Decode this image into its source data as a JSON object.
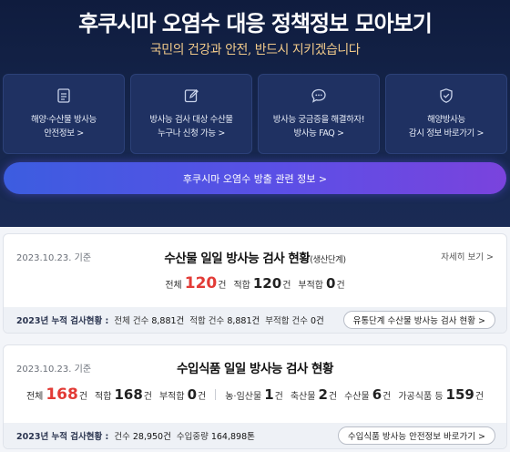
{
  "hero": {
    "title": "후쿠시마 오염수 대응 정책정보 모아보기",
    "subtitle": "국민의 건강과 안전, 반드시 지키겠습니다"
  },
  "cards": [
    {
      "icon": "document-icon",
      "line1": "해양·수산물 방사능",
      "line2": "안전정보 >"
    },
    {
      "icon": "edit-icon",
      "line1": "방사능 검사 대상 수산물",
      "line2": "누구나 신청 가능 >"
    },
    {
      "icon": "chat-icon",
      "line1": "방사능 궁금증을 해결하자!",
      "line2": "방사능 FAQ >"
    },
    {
      "icon": "shield-icon",
      "line1": "해양방사능",
      "line2": "감시 정보 바로가기 >"
    }
  ],
  "discharge_button": "후쿠시마 오염수 방출 관련 정보 >",
  "seafood": {
    "date": "2023.10.23. 기준",
    "title": "수산물 일일 방사능 검사 현황",
    "title_note": "(생산단계)",
    "more": "자세히 보기 >",
    "stats": [
      {
        "label": "전체",
        "value": "120",
        "unit": "건"
      },
      {
        "label": "적합",
        "value": "120",
        "unit": "건"
      },
      {
        "label": "부적합",
        "value": "0",
        "unit": "건"
      }
    ],
    "cumulative_label": "2023년 누적 검사현황 :",
    "cumulative": [
      {
        "label": "전체 건수",
        "value": "8,881건"
      },
      {
        "label": "적합 건수",
        "value": "8,881건"
      },
      {
        "label": "부적합 건수",
        "value": "0건"
      }
    ],
    "link": "유통단계 수산물 방사능 검사 현황 >"
  },
  "imported": {
    "date": "2023.10.23. 기준",
    "title": "수입식품 일일 방사능 검사 현황",
    "stats": [
      {
        "label": "전체",
        "value": "168",
        "unit": "건"
      },
      {
        "label": "적합",
        "value": "168",
        "unit": "건"
      },
      {
        "label": "부적합",
        "value": "0",
        "unit": "건"
      }
    ],
    "stats2": [
      {
        "label": "농·임산물",
        "value": "1",
        "unit": "건"
      },
      {
        "label": "축산물",
        "value": "2",
        "unit": "건"
      },
      {
        "label": "수산물",
        "value": "6",
        "unit": "건"
      },
      {
        "label": "가공식품 등",
        "value": "159",
        "unit": "건"
      }
    ],
    "cumulative_label": "2023년 누적 검사현황 :",
    "cumulative": [
      {
        "label": "건수",
        "value": "28,950건"
      },
      {
        "label": "수입중량",
        "value": "164,898톤"
      }
    ],
    "link": "수입식품 방사능 안전정보 바로가기 >"
  },
  "colors": {
    "accent_red": "#e23b36",
    "hero_bg": "#16264d",
    "subtitle_gold": "#f0c98a"
  }
}
